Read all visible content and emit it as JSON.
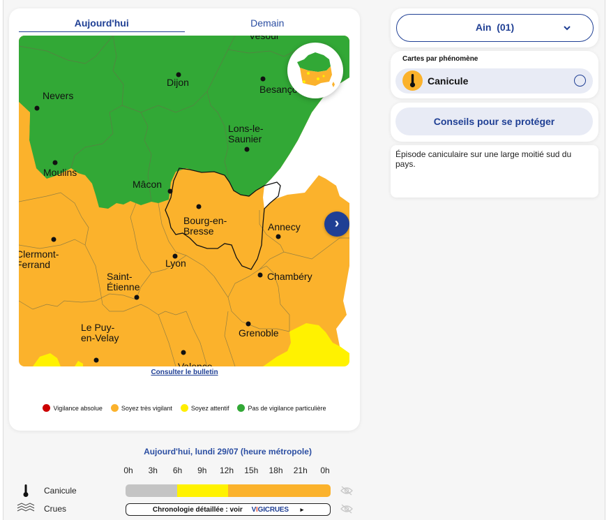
{
  "tabs": [
    {
      "label": "Aujourd'hui",
      "active": true
    },
    {
      "label": "Demain",
      "active": false
    }
  ],
  "map": {
    "cities": {
      "vesoul": "Vesoul",
      "nevers": "Nevers",
      "dijon": "Dijon",
      "besancon": "Besançon",
      "lons1": "Lons-le-",
      "lons2": "Saunier",
      "moulins": "Moulins",
      "macon": "Mâcon",
      "bourg1": "Bourg-en-",
      "bourg2": "Bresse",
      "annecy": "Annecy",
      "clermont1": "Clermont-",
      "clermont2": "Ferrand",
      "lyon": "Lyon",
      "chambery": "Chambéry",
      "stetienne1": "Saint-",
      "stetienne2": "Étienne",
      "lepuy1": "Le Puy-",
      "lepuy2": "en-Velay",
      "grenoble": "Grenoble",
      "valence": "Valence"
    },
    "selected_department": "Ain",
    "mini_map_icon": "france-mini-map",
    "next_icon": "chevron-right-icon",
    "next_glyph": "›"
  },
  "bulletin_link": "Consulter le bulletin",
  "legend": [
    {
      "label": "Vigilance absolue",
      "color": "#cc0000"
    },
    {
      "label": "Soyez très vigilant",
      "color": "#fbb22c"
    },
    {
      "label": "Soyez attentif",
      "color": "#ffee00"
    },
    {
      "label": "Pas de vigilance particulière",
      "color": "#32a836"
    }
  ],
  "colors": {
    "green": "#32a836",
    "orange": "#fbb22c",
    "yellow": "#fff200",
    "red": "#cc0000",
    "accent": "#1f3f94"
  },
  "timeline": {
    "title": "Aujourd'hui, lundi 29/07 (heure métropole)",
    "hours": [
      "0h",
      "3h",
      "6h",
      "9h",
      "12h",
      "15h",
      "18h",
      "21h",
      "0h"
    ],
    "rows": [
      {
        "label": "Canicule",
        "icon": "thermometer-icon",
        "segments": [
          {
            "from": "0h",
            "to": "6h",
            "level": "none",
            "color": "#c4c4c4"
          },
          {
            "from": "6h",
            "to": "12h",
            "level": "yellow",
            "color": "#fff200"
          },
          {
            "from": "12h",
            "to": "24h",
            "level": "orange",
            "color": "#fbb22c"
          }
        ]
      },
      {
        "label": "Crues",
        "icon": "waves-icon",
        "link_text": "Chronologie détaillée : voir",
        "logo_v": "V",
        "logo_i": "I",
        "logo_rest": "GICRUES",
        "arrow": "▸"
      }
    ]
  },
  "sidebar": {
    "department": "Ain  (01)",
    "phenomena_title": "Cartes par phénomène",
    "phenomenon": "Canicule",
    "conseils": "Conseils pour se protéger",
    "comment": "Épisode caniculaire sur une large moitié sud du pays."
  }
}
